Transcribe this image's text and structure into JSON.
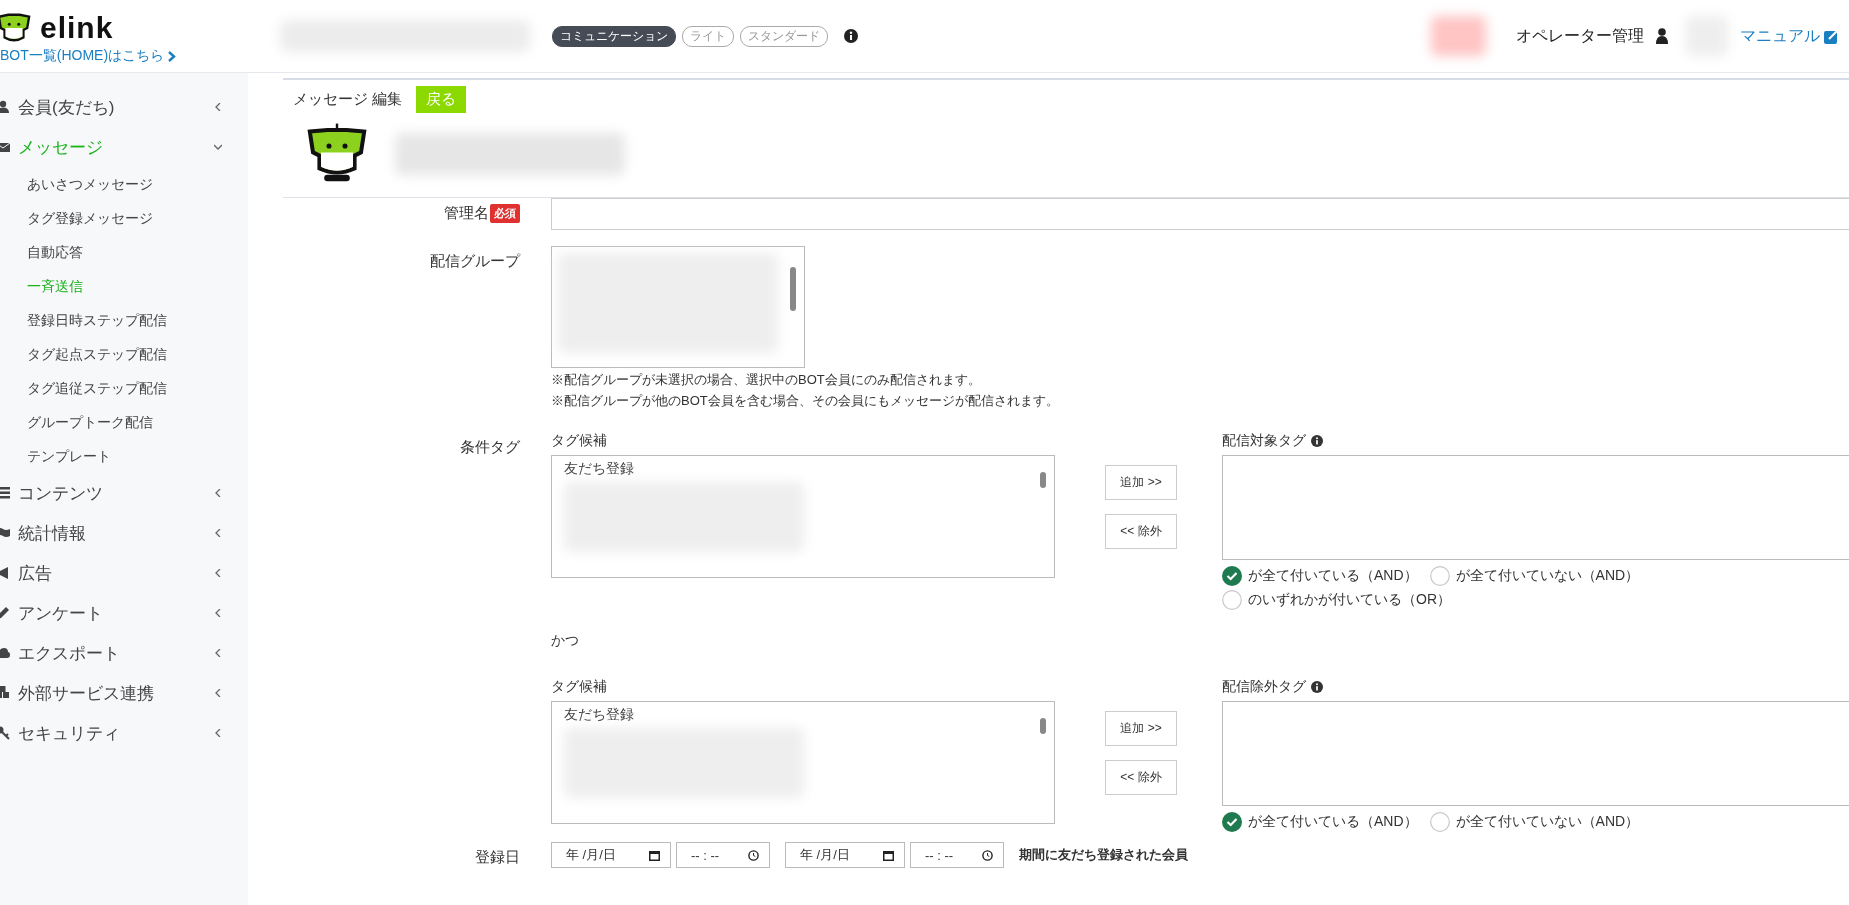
{
  "header": {
    "logo_text": "elink",
    "home_link": "BOT一覧(HOME)はこちら",
    "plan_badges": [
      {
        "label": "コミュニケーション",
        "selected": true
      },
      {
        "label": "ライト",
        "selected": false
      },
      {
        "label": "スタンダード",
        "selected": false
      }
    ],
    "operator_menu": "オペレーター管理",
    "manual_link": "マニュアル"
  },
  "sidebar": {
    "items": [
      {
        "label": "会員(友だち)",
        "expanded": false,
        "selected": false
      },
      {
        "label": "メッセージ",
        "expanded": true,
        "selected": true,
        "children": [
          {
            "label": "あいさつメッセージ",
            "selected": false
          },
          {
            "label": "タグ登録メッセージ",
            "selected": false
          },
          {
            "label": "自動応答",
            "selected": false
          },
          {
            "label": "一斉送信",
            "selected": true
          },
          {
            "label": "登録日時ステップ配信",
            "selected": false
          },
          {
            "label": "タグ起点ステップ配信",
            "selected": false
          },
          {
            "label": "タグ追従ステップ配信",
            "selected": false
          },
          {
            "label": "グループトーク配信",
            "selected": false
          },
          {
            "label": "テンプレート",
            "selected": false
          }
        ]
      },
      {
        "label": "コンテンツ",
        "expanded": false,
        "selected": false
      },
      {
        "label": "統計情報",
        "expanded": false,
        "selected": false
      },
      {
        "label": "広告",
        "expanded": false,
        "selected": false
      },
      {
        "label": "アンケート",
        "expanded": false,
        "selected": false
      },
      {
        "label": "エクスポート",
        "expanded": false,
        "selected": false
      },
      {
        "label": "外部サービス連携",
        "expanded": false,
        "selected": false
      },
      {
        "label": "セキュリティ",
        "expanded": false,
        "selected": false
      }
    ]
  },
  "page": {
    "title": "メッセージ 編集",
    "back_button": "戻る"
  },
  "form": {
    "name_field": {
      "label": "管理名",
      "required_badge": "必須"
    },
    "group_field": {
      "label": "配信グループ",
      "notes": [
        "※配信グループが未選択の場合、選択中のBOT会員にのみ配信されます。",
        "※配信グループが他のBOT会員を含む場合、その会員にもメッセージが配信されます。"
      ]
    },
    "condition_tags": {
      "label": "条件タグ",
      "conjunction": "かつ",
      "blocks": [
        {
          "candidates_label": "タグ候補",
          "candidates": [
            "友だち登録"
          ],
          "add_button": "追加 >>",
          "remove_button": "<< 除外",
          "target_label": "配信対象タグ",
          "options": [
            {
              "label": "が全て付いている（AND）",
              "selected": true
            },
            {
              "label": "が全て付いていない（AND）",
              "selected": false
            },
            {
              "label": "のいずれかが付いている（OR）",
              "selected": false
            }
          ]
        },
        {
          "candidates_label": "タグ候補",
          "candidates": [
            "友だち登録"
          ],
          "add_button": "追加 >>",
          "remove_button": "<< 除外",
          "target_label": "配信除外タグ",
          "options": [
            {
              "label": "が全て付いている（AND）",
              "selected": true
            },
            {
              "label": "が全て付いていない（AND）",
              "selected": false
            }
          ]
        }
      ]
    },
    "registration_date": {
      "label": "登録日",
      "ranges": [
        {
          "date_placeholder": "年 /月/日",
          "time_placeholder": "-- : --"
        },
        {
          "date_placeholder": "年 /月/日",
          "time_placeholder": "-- : --"
        }
      ],
      "note": "期間に友だち登録された会員"
    }
  }
}
